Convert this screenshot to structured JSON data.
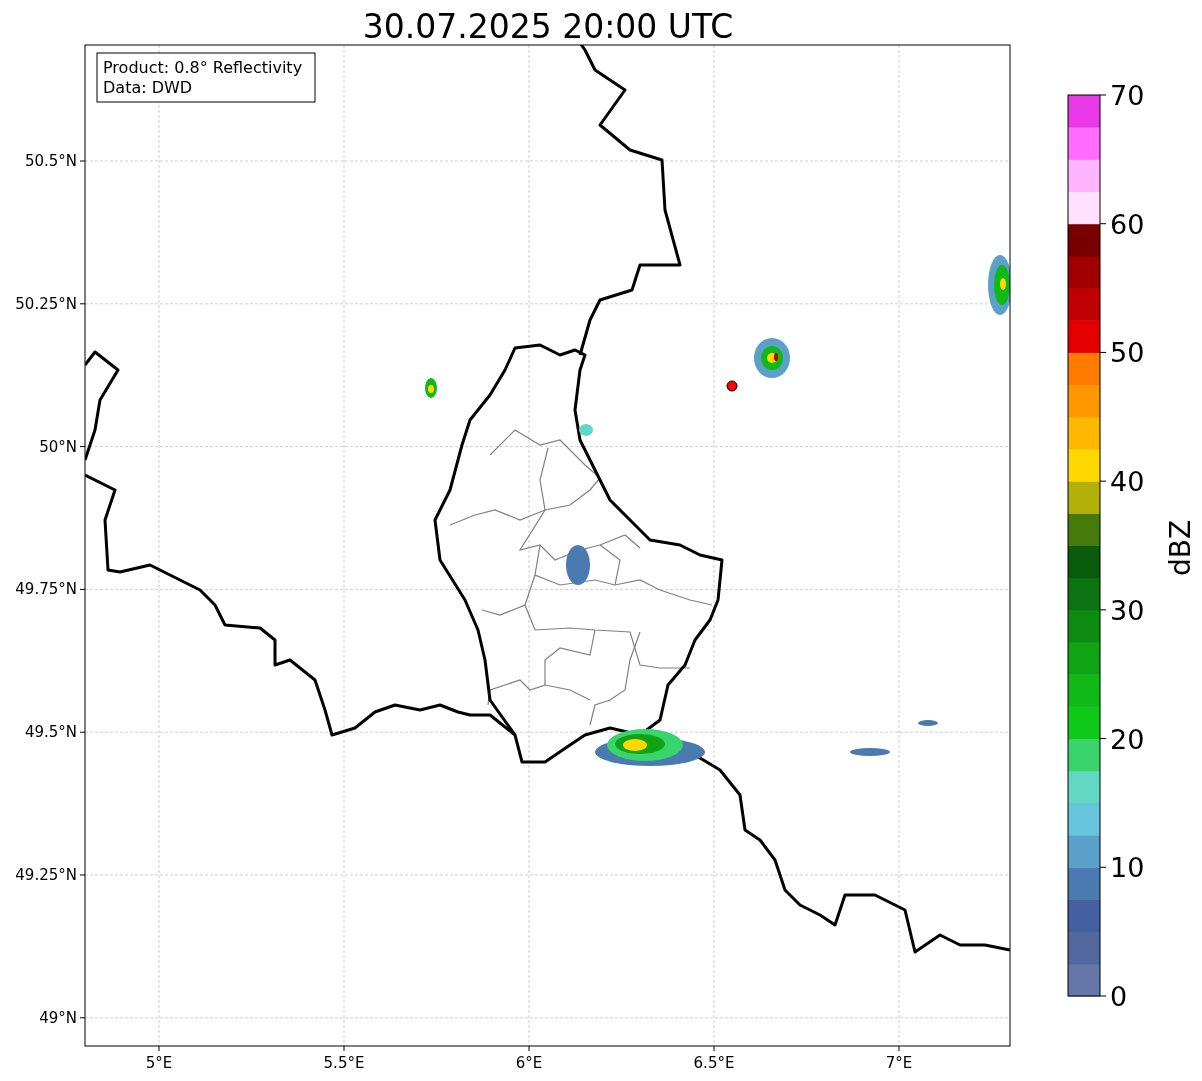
{
  "title": "30.07.2025 20:00 UTC",
  "info_box": [
    "Product: 0.8° Reflectivity",
    "Data: DWD"
  ],
  "map": {
    "kind": "map",
    "xticks": [
      "5°E",
      "5.5°E",
      "6°E",
      "6.5°E",
      "7°E"
    ],
    "yticks": [
      "50.5°N",
      "50.25°N",
      "50°N",
      "49.75°N",
      "49.5°N",
      "49.25°N",
      "49°N"
    ]
  },
  "colorbar": {
    "label": "dBZ",
    "ticks": [
      "70",
      "60",
      "50",
      "40",
      "30",
      "20",
      "10",
      "0"
    ],
    "segments": [
      {
        "color": "#6577a8"
      },
      {
        "color": "#5468a0"
      },
      {
        "color": "#4460a0"
      },
      {
        "color": "#4a7ab0"
      },
      {
        "color": "#5aa0c8"
      },
      {
        "color": "#66c4dc"
      },
      {
        "color": "#62d8c4"
      },
      {
        "color": "#3ad46c"
      },
      {
        "color": "#10c818"
      },
      {
        "color": "#10b818"
      },
      {
        "color": "#10a414"
      },
      {
        "color": "#0e8c12"
      },
      {
        "color": "#0c7410"
      },
      {
        "color": "#085c0c"
      },
      {
        "color": "#467a0a"
      },
      {
        "color": "#b0b006"
      },
      {
        "color": "#ffd800"
      },
      {
        "color": "#ffb800"
      },
      {
        "color": "#ff9800"
      },
      {
        "color": "#ff7c00"
      },
      {
        "color": "#e40000"
      },
      {
        "color": "#c00000"
      },
      {
        "color": "#a00000"
      },
      {
        "color": "#780000"
      },
      {
        "color": "#ffe0ff"
      },
      {
        "color": "#ffb4ff"
      },
      {
        "color": "#ff6cff"
      },
      {
        "color": "#e838e8"
      }
    ]
  }
}
